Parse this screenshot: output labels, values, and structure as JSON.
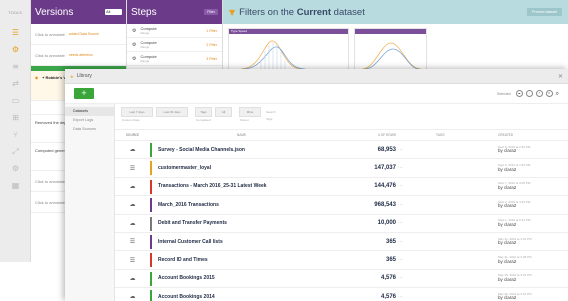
{
  "rail": {
    "header": "TOOLS"
  },
  "versions": {
    "title": "Versions",
    "filter": "All",
    "rows": [
      {
        "text": "Click to annotate",
        "note": "added Data Source"
      },
      {
        "text": "Click to annotate",
        "note": "needs attention"
      }
    ],
    "active": {
      "title": "+ Robbie's Version",
      "sub": "Library"
    },
    "long_rows": [
      {
        "text": "Removed the dependencies"
      },
      {
        "text": "Computed generation lines"
      }
    ],
    "bottom_rows": [
      {
        "text": "Click to annotate"
      },
      {
        "text": "Click to annotate"
      }
    ]
  },
  "steps": {
    "title": "Steps",
    "filter": "Filter",
    "rows": [
      {
        "name": "Compute",
        "sub": "Range",
        "status": "1 Filter"
      },
      {
        "name": "Compute",
        "sub": "Range",
        "status": "2 Filter"
      },
      {
        "name": "Compute",
        "sub": "Range",
        "status": "3 Filter"
      }
    ]
  },
  "filters": {
    "title_prefix": "Filters on the ",
    "title_emph": "Current",
    "title_suffix": " dataset",
    "button": "Preview dataset",
    "card_label": "Type Speed"
  },
  "window": {
    "library": "Library",
    "add": "+",
    "selected": "Selected",
    "sidebar": [
      "Datasets",
      "Export Logs",
      "Data Sources"
    ],
    "filters": [
      {
        "label": "Last 7 days",
        "sub": "Custom Date"
      },
      {
        "label": "Last 30 days",
        "sub": ""
      },
      {
        "label": "Tags",
        "sub": "Completed"
      },
      {
        "label": "All",
        "sub": ""
      },
      {
        "label": "Mine",
        "sub": "Owner"
      }
    ],
    "search_label": "Search",
    "tags_label": "Tags",
    "columns": [
      "Source",
      "Name",
      "# of Rows",
      "Tags",
      "Created"
    ],
    "rows": [
      {
        "name": "Survey - Social Media Channels.json",
        "rows": "68,953",
        "src": "☁",
        "color": "#3aa63a",
        "date": "Sept 9, 2016 at 2:32 PM",
        "by": "by clara2"
      },
      {
        "name": "customermaster_loyal",
        "rows": "147,037",
        "src": "☰",
        "color": "#e8a020",
        "date": "Sept 9, 2016 at 1:52 PM",
        "by": "by clara2"
      },
      {
        "name": "Transactions - March 2016_25-31 Latest Week",
        "rows": "144,476",
        "src": "☁",
        "color": "#d8382c",
        "date": "Sept 7, 2016 at 3:05 PM",
        "by": "by clara2"
      },
      {
        "name": "March_2016 Transactions",
        "rows": "968,543",
        "src": "☁",
        "color": "#6b3b8a",
        "date": "Sept 2, 2016 at 4:20 PM",
        "by": "by clara2"
      },
      {
        "name": "Debit and Transfer Payments",
        "rows": "10,000",
        "src": "☁",
        "color": "#7a7a7a",
        "date": "Sept 1, 2016 at 8:14 PM",
        "by": "by clara2"
      },
      {
        "name": "Internal Customer Call lists",
        "rows": "365",
        "src": "☰",
        "color": "#6b3b8a",
        "date": "May 31, 2016 at 4:10 PM",
        "by": "by clara2"
      },
      {
        "name": "Record ID and Times",
        "rows": "365",
        "src": "☰",
        "color": "#d8382c",
        "date": "May 31, 2016 at 3:28 PM",
        "by": "by clara2"
      },
      {
        "name": "Account Bookings 2015",
        "rows": "4,576",
        "src": "☁",
        "color": "#3aa63a",
        "date": "May 25, 2016 at 3:21 PM",
        "by": "by clara2"
      },
      {
        "name": "Account Bookings 2014",
        "rows": "4,576",
        "src": "☁",
        "color": "#3aa63a",
        "date": "May 25, 2016 at 3:15 PM",
        "by": "by clara2"
      }
    ]
  }
}
